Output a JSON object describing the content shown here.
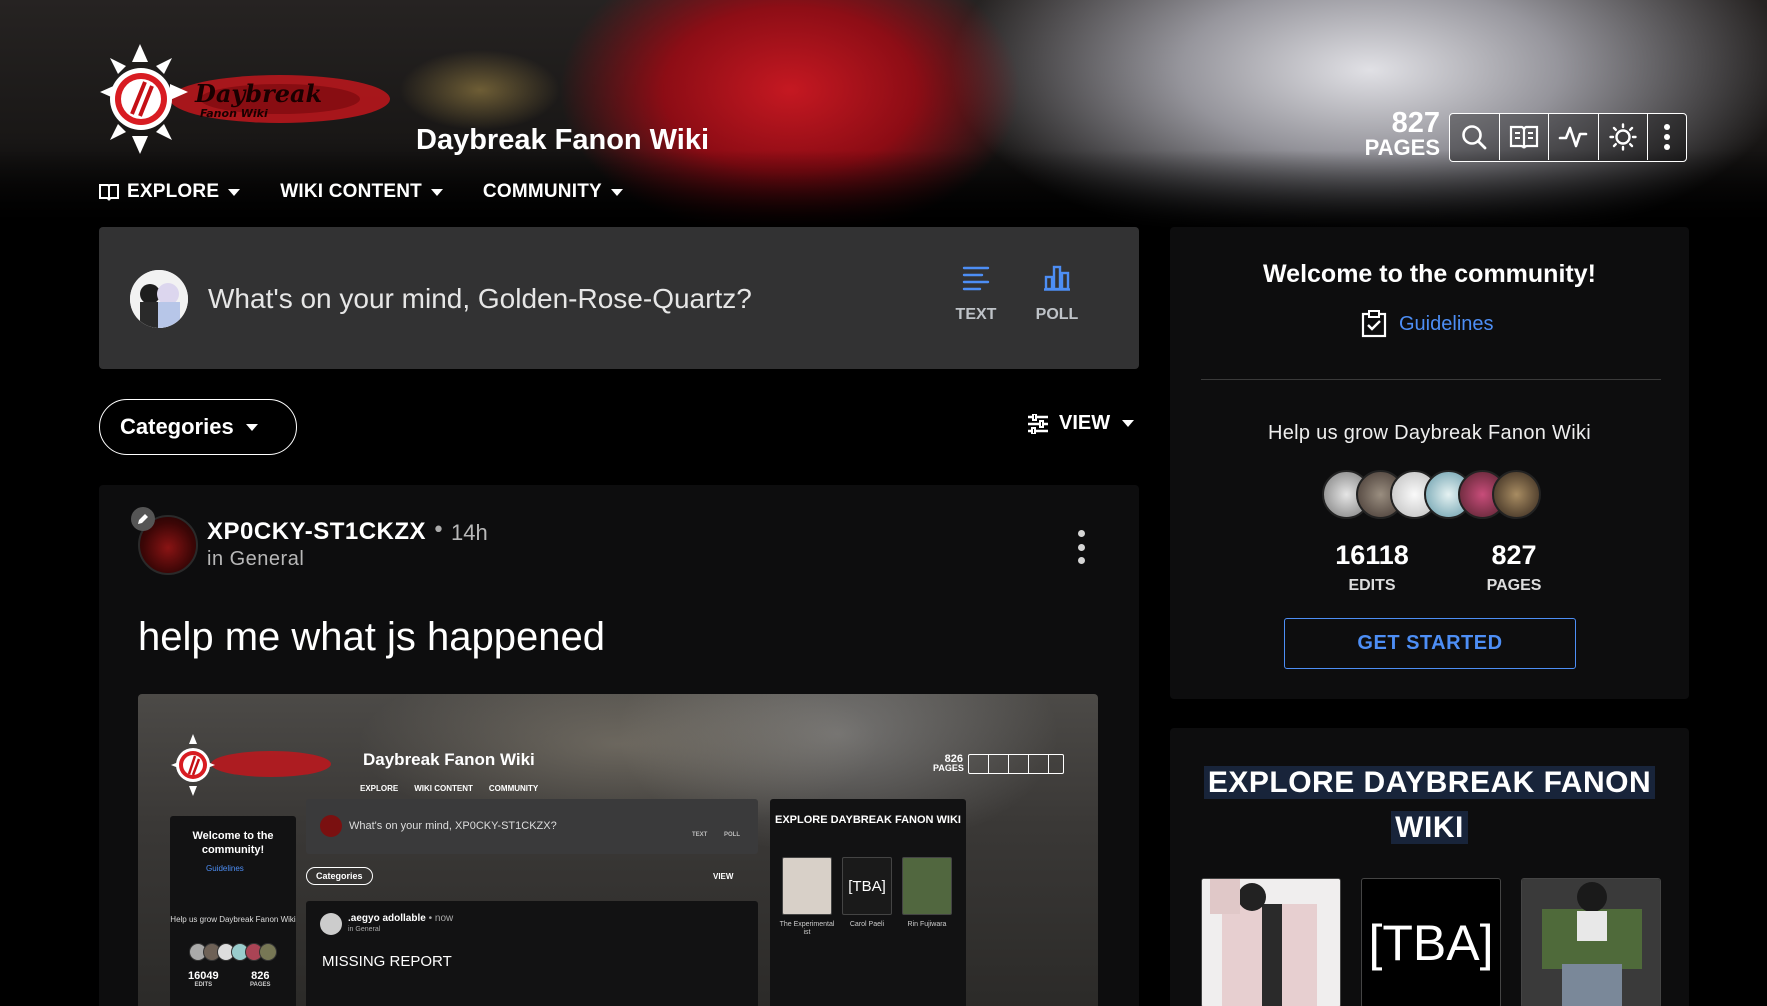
{
  "header": {
    "logo_text": "Daybreak",
    "logo_subtext": "Fanon Wiki",
    "site_title": "Daybreak Fanon Wiki",
    "page_count": "827",
    "page_count_label": "PAGES",
    "tools": [
      "search-icon",
      "map-book-icon",
      "activity-icon",
      "theme-icon",
      "more-icon"
    ]
  },
  "nav": {
    "explore": "EXPLORE",
    "wiki_content": "WIKI CONTENT",
    "community": "COMMUNITY"
  },
  "composer": {
    "prompt": "What's on your mind, Golden-Rose-Quartz?",
    "text_label": "TEXT",
    "poll_label": "POLL"
  },
  "filters": {
    "categories_label": "Categories",
    "view_label": "VIEW"
  },
  "post": {
    "author": "XP0CKY-ST1CKZX",
    "time": "14h",
    "category": "in General",
    "title": "help me what js happened"
  },
  "screenshot": {
    "site_title": "Daybreak Fanon Wiki",
    "nav": [
      "EXPLORE",
      "WIKI CONTENT",
      "COMMUNITY"
    ],
    "page_count": "826",
    "page_count_label": "PAGES",
    "welcome": "Welcome to the community!",
    "guidelines": "Guidelines",
    "help": "Help us grow Daybreak Fanon Wiki",
    "edits": "16049",
    "edits_label": "EDITS",
    "pages": "826",
    "pages_label": "PAGES",
    "composer_prompt": "What's on your mind, XP0CKY-ST1CKZX?",
    "text_label": "TEXT",
    "poll_label": "POLL",
    "categories_label": "Categories",
    "view_label": "VIEW",
    "post_author": ".aegyo adollable",
    "post_time": "now",
    "post_category": "in General",
    "post_title": "MISSING REPORT",
    "explore_title": "EXPLORE DAYBREAK FANON WIKI",
    "card_captions": [
      "The Experimental ist",
      "Carol Paeli",
      "Rin Fujiwara"
    ],
    "card_tba": "[TBA]"
  },
  "rail": {
    "welcome": "Welcome to the community!",
    "guidelines": "Guidelines",
    "help": "Help us grow Daybreak Fanon Wiki",
    "edits": "16118",
    "edits_label": "EDITS",
    "pages": "827",
    "pages_label": "PAGES",
    "get_started": "GET STARTED"
  },
  "explore": {
    "title": "EXPLORE DAYBREAK FANON WIKI",
    "tba": "[TBA]"
  },
  "colors": {
    "accent": "#4d8ef5",
    "panel": "#323233",
    "card": "#0d0d0e"
  }
}
